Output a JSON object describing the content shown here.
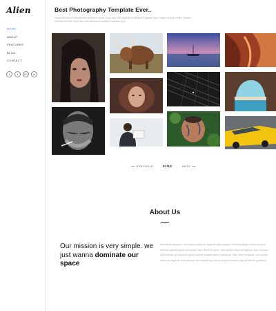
{
  "sidebar": {
    "logo": "Alien",
    "nav": [
      "HOME",
      "ABOUT",
      "FEATURES",
      "BLOG",
      "CONTACT"
    ],
    "socials": [
      "f",
      "t",
      "G+",
      "in"
    ]
  },
  "header": {
    "title": "Best Photography Template Ever..",
    "intro": "Nullam id dolor id nibh ultricies vehicula ut id elit. Cras justo odio dapibus ac facilisis in egestas eget. Nullam id dolor id nibh ultricies vehicula ut id elit. Cras justo odio dapibus ac facilisis in egestas eget."
  },
  "gallery": {
    "photos": [
      "woman-portrait",
      "highland-cow",
      "boat-sunset",
      "canyon-rocks",
      "girl-portrait",
      "dark-pier",
      "sea-cave",
      "old-man-smoking",
      "man-reading",
      "tattooed-man",
      "yellow-taxi"
    ]
  },
  "pagination": {
    "prev": "PREVIOUS",
    "current": "01/12",
    "next": "NEXT"
  },
  "about": {
    "heading": "About Us",
    "mission_text": "Our mission is very simple. we just wanna ",
    "mission_bold": "dominate our space",
    "paragraph": "Nam libero tempore, cum soluta nobis est eligendi optio cumque nihil impedit quo minus id quod maxime placeat facere possimus. Nam libero tempore, cum soluta nobis est eligendi optio cumque nihil impedit quo minus id quod maxime placeat facere possimus. Nam libero tempore, cum soluta nobis est eligendi optio cumque nihil impedit quo minus id quod maxime placeat facere possimus."
  },
  "colors": {
    "accent": "#2f80ed",
    "text": "#222222",
    "muted": "#aaaaaa"
  }
}
